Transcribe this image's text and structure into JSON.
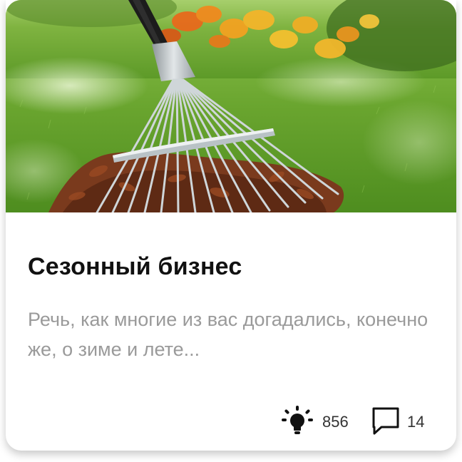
{
  "card": {
    "title": "Сезонный бизнес",
    "excerpt": "Речь, как многие из вас догадались, конечно же, о зиме и лете...",
    "image_alt": "Грабли на газоне с опавшими листьями",
    "stats": {
      "views": "856",
      "comments": "14"
    },
    "icons": {
      "views": "lightbulb-icon",
      "comments": "speech-bubble-icon"
    }
  },
  "colors": {
    "title": "#111111",
    "excerpt": "#9a9a9a",
    "count": "#333333",
    "icon": "#111111"
  }
}
